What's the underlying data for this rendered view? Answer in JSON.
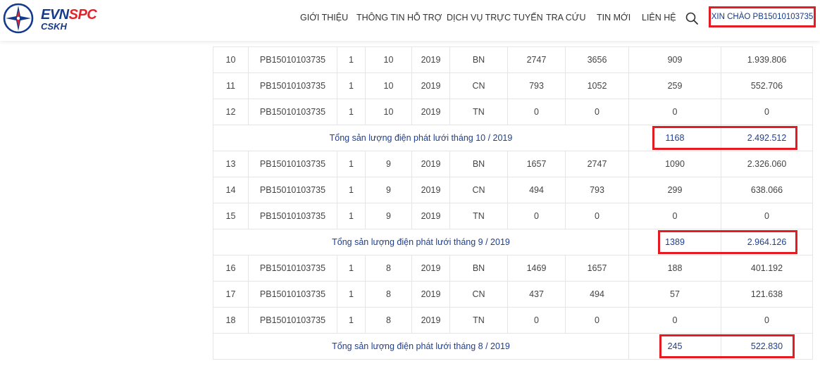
{
  "brand": {
    "evn": "EVN",
    "spc": "SPC",
    "sub": "CSKH"
  },
  "nav": {
    "items": [
      "GIỚI THIỆU",
      "THÔNG TIN HỖ TRỢ",
      "DỊCH VỤ TRỰC TUYẾN",
      "TRA CỨU",
      "TIN MỚI",
      "LIÊN HỆ"
    ],
    "search_icon": "search-icon",
    "greeting": "XIN CHÀO PB15010103735"
  },
  "table": {
    "rows": [
      {
        "kind": "data",
        "cells": [
          "10",
          "PB15010103735",
          "1",
          "10",
          "2019",
          "BN",
          "2747",
          "3656",
          "909",
          "1.939.806"
        ]
      },
      {
        "kind": "data",
        "cells": [
          "11",
          "PB15010103735",
          "1",
          "10",
          "2019",
          "CN",
          "793",
          "1052",
          "259",
          "552.706"
        ]
      },
      {
        "kind": "data",
        "cells": [
          "12",
          "PB15010103735",
          "1",
          "10",
          "2019",
          "TN",
          "0",
          "0",
          "0",
          "0"
        ]
      },
      {
        "kind": "total",
        "label": "Tổng sản lượng điện phát lưới tháng 10 / 2019",
        "qty": "1168",
        "amount": "2.492.512"
      },
      {
        "kind": "data",
        "cells": [
          "13",
          "PB15010103735",
          "1",
          "9",
          "2019",
          "BN",
          "1657",
          "2747",
          "1090",
          "2.326.060"
        ]
      },
      {
        "kind": "data",
        "cells": [
          "14",
          "PB15010103735",
          "1",
          "9",
          "2019",
          "CN",
          "494",
          "793",
          "299",
          "638.066"
        ]
      },
      {
        "kind": "data",
        "cells": [
          "15",
          "PB15010103735",
          "1",
          "9",
          "2019",
          "TN",
          "0",
          "0",
          "0",
          "0"
        ]
      },
      {
        "kind": "total",
        "label": "Tổng sản lượng điện phát lưới tháng 9 / 2019",
        "qty": "1389",
        "amount": "2.964.126"
      },
      {
        "kind": "data",
        "cells": [
          "16",
          "PB15010103735",
          "1",
          "8",
          "2019",
          "BN",
          "1469",
          "1657",
          "188",
          "401.192"
        ]
      },
      {
        "kind": "data",
        "cells": [
          "17",
          "PB15010103735",
          "1",
          "8",
          "2019",
          "CN",
          "437",
          "494",
          "57",
          "121.638"
        ]
      },
      {
        "kind": "data",
        "cells": [
          "18",
          "PB15010103735",
          "1",
          "8",
          "2019",
          "TN",
          "0",
          "0",
          "0",
          "0"
        ]
      },
      {
        "kind": "total",
        "label": "Tổng sản lượng điện phát lưới tháng 8 / 2019",
        "qty": "245",
        "amount": "522.830"
      }
    ]
  },
  "colors": {
    "brand_blue": "#143a8c",
    "brand_red": "#e3222a",
    "highlight": "#e31b23",
    "total_text": "#1f3f8f"
  }
}
